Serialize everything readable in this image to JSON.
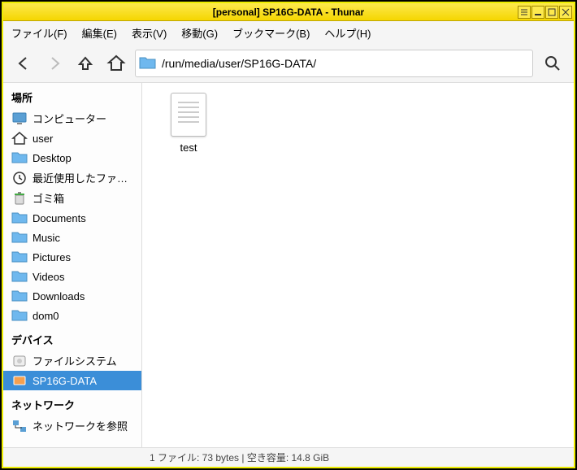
{
  "title": "[personal] SP16G-DATA - Thunar",
  "menu": {
    "file": "ファイル(F)",
    "edit": "編集(E)",
    "view": "表示(V)",
    "go": "移動(G)",
    "bookmarks": "ブックマーク(B)",
    "help": "ヘルプ(H)"
  },
  "path": "/run/media/user/SP16G-DATA/",
  "sidebar": {
    "places_head": "場所",
    "devices_head": "デバイス",
    "network_head": "ネットワーク",
    "places": [
      {
        "label": "コンピューター",
        "icon": "computer"
      },
      {
        "label": "user",
        "icon": "home"
      },
      {
        "label": "Desktop",
        "icon": "folder"
      },
      {
        "label": "最近使用したファ…",
        "icon": "recent"
      },
      {
        "label": "ゴミ箱",
        "icon": "trash"
      },
      {
        "label": "Documents",
        "icon": "folder"
      },
      {
        "label": "Music",
        "icon": "folder"
      },
      {
        "label": "Pictures",
        "icon": "folder"
      },
      {
        "label": "Videos",
        "icon": "folder"
      },
      {
        "label": "Downloads",
        "icon": "folder"
      },
      {
        "label": "dom0",
        "icon": "folder"
      }
    ],
    "devices": [
      {
        "label": "ファイルシステム",
        "icon": "disk",
        "selected": false
      },
      {
        "label": "SP16G-DATA",
        "icon": "usb",
        "selected": true
      }
    ],
    "network": [
      {
        "label": "ネットワークを参照",
        "icon": "network"
      }
    ]
  },
  "files": [
    {
      "name": "test"
    }
  ],
  "status": "1 ファイル: 73 bytes  |  空き容量: 14.8 GiB"
}
